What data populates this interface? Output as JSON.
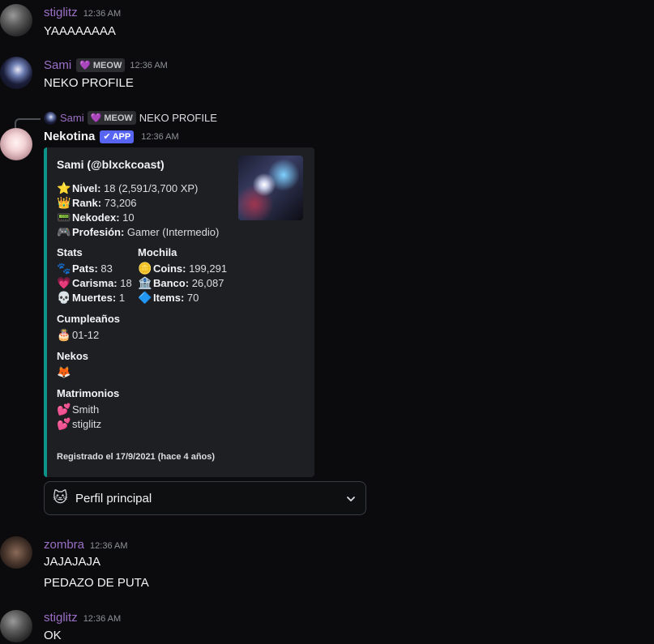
{
  "messages": [
    {
      "username": "stiglitz",
      "time": "12:36 AM",
      "lines": [
        "YAAAAAAAA"
      ]
    },
    {
      "username": "Sami",
      "tag": "MEOW",
      "time": "12:36 AM",
      "lines": [
        "NEKO PROFILE"
      ]
    },
    {
      "username": "Nekotina",
      "badge": "APP",
      "time": "12:36 AM"
    },
    {
      "username": "zombra",
      "time": "12:36 AM",
      "lines": [
        "JAJAJAJA",
        "PEDAZO DE PUTA"
      ]
    },
    {
      "username": "stiglitz",
      "time": "12:36 AM",
      "lines": [
        "OK"
      ]
    }
  ],
  "reply": {
    "username": "Sami",
    "tag": "MEOW",
    "text": "NEKO PROFILE"
  },
  "embed": {
    "title": "Sami (@blxckcoast)",
    "info": [
      {
        "icon": "⭐",
        "label": "Nivel:",
        "value": "18 (2,591/3,700 XP)"
      },
      {
        "icon": "👑",
        "label": "Rank:",
        "value": "73,206"
      },
      {
        "icon": "📟",
        "label": "Nekodex:",
        "value": "10"
      },
      {
        "icon": "🎮",
        "label": "Profesión:",
        "value": "Gamer (Intermedio)"
      }
    ],
    "stats_heading": "Stats",
    "stats": [
      {
        "icon": "🐾",
        "label": "Pats:",
        "value": "83"
      },
      {
        "icon": "💗",
        "label": "Carisma:",
        "value": "18"
      },
      {
        "icon": "💀",
        "label": "Muertes:",
        "value": "1"
      }
    ],
    "mochila_heading": "Mochila",
    "mochila": [
      {
        "icon": "🪙",
        "label": "Coins:",
        "value": "199,291"
      },
      {
        "icon": "🏦",
        "label": "Banco:",
        "value": "26,087"
      },
      {
        "icon": "🔷",
        "label": "Items:",
        "value": "70"
      }
    ],
    "birthday_heading": "Cumpleaños",
    "birthday": {
      "icon": "🎂",
      "value": "01-12"
    },
    "nekos_heading": "Nekos",
    "nekos_icon": "🦊",
    "marriages_heading": "Matrimonios",
    "marriages": [
      {
        "icon": "💕",
        "name": "Smith"
      },
      {
        "icon": "💕",
        "name": "stiglitz"
      }
    ],
    "footer": "Registrado el 17/9/2021 (hace 4 años)"
  },
  "select": {
    "icon": "🐱",
    "label": "Perfil principal",
    "chevron": "chevron-down-icon"
  },
  "colors": {
    "background": "#0b0b0d",
    "username": "#9b6fc5",
    "embed_border": "#0d9488",
    "app_badge": "#5865f2"
  }
}
